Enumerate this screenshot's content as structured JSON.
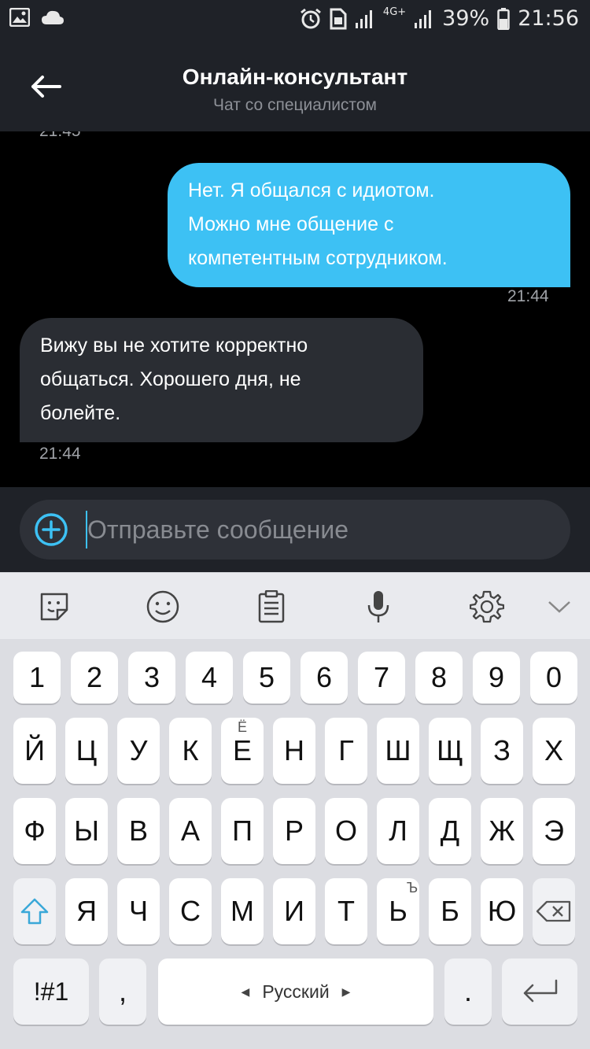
{
  "status_bar": {
    "network": "4G+",
    "battery": "39%",
    "time": "21:56"
  },
  "header": {
    "title": "Онлайн-консультант",
    "subtitle": "Чат со специалистом"
  },
  "chat": {
    "cut_time": "21:45",
    "messages": [
      {
        "direction": "out",
        "lines": [
          "Нет. Я общался с идиотом.",
          "Можно мне общение с",
          "компетентным сотрудником."
        ],
        "time": "21:44"
      },
      {
        "direction": "in",
        "lines": [
          "Вижу вы не хотите корректно",
          "общаться. Хорошего дня, не",
          "болейте."
        ],
        "time": "21:44"
      }
    ]
  },
  "composer": {
    "placeholder": "Отправьте сообщение"
  },
  "keyboard": {
    "row_numbers": [
      "1",
      "2",
      "3",
      "4",
      "5",
      "6",
      "7",
      "8",
      "9",
      "0"
    ],
    "row1": [
      "Й",
      "Ц",
      "У",
      "К",
      "Е",
      "Н",
      "Г",
      "Ш",
      "Щ",
      "З",
      "Х"
    ],
    "row1_hint_e": "Ё",
    "row2": [
      "Ф",
      "Ы",
      "В",
      "А",
      "П",
      "Р",
      "О",
      "Л",
      "Д",
      "Ж",
      "Э"
    ],
    "row3": [
      "Я",
      "Ч",
      "С",
      "М",
      "И",
      "Т",
      "Ь",
      "Б",
      "Ю"
    ],
    "row3_hint_soft": "Ъ",
    "symbols": "!#1",
    "comma": ",",
    "space": "Русский",
    "period": "."
  },
  "colors": {
    "accent": "#3dc1f4",
    "header_bg": "#1f2228",
    "bubble_in": "#2a2d33"
  }
}
